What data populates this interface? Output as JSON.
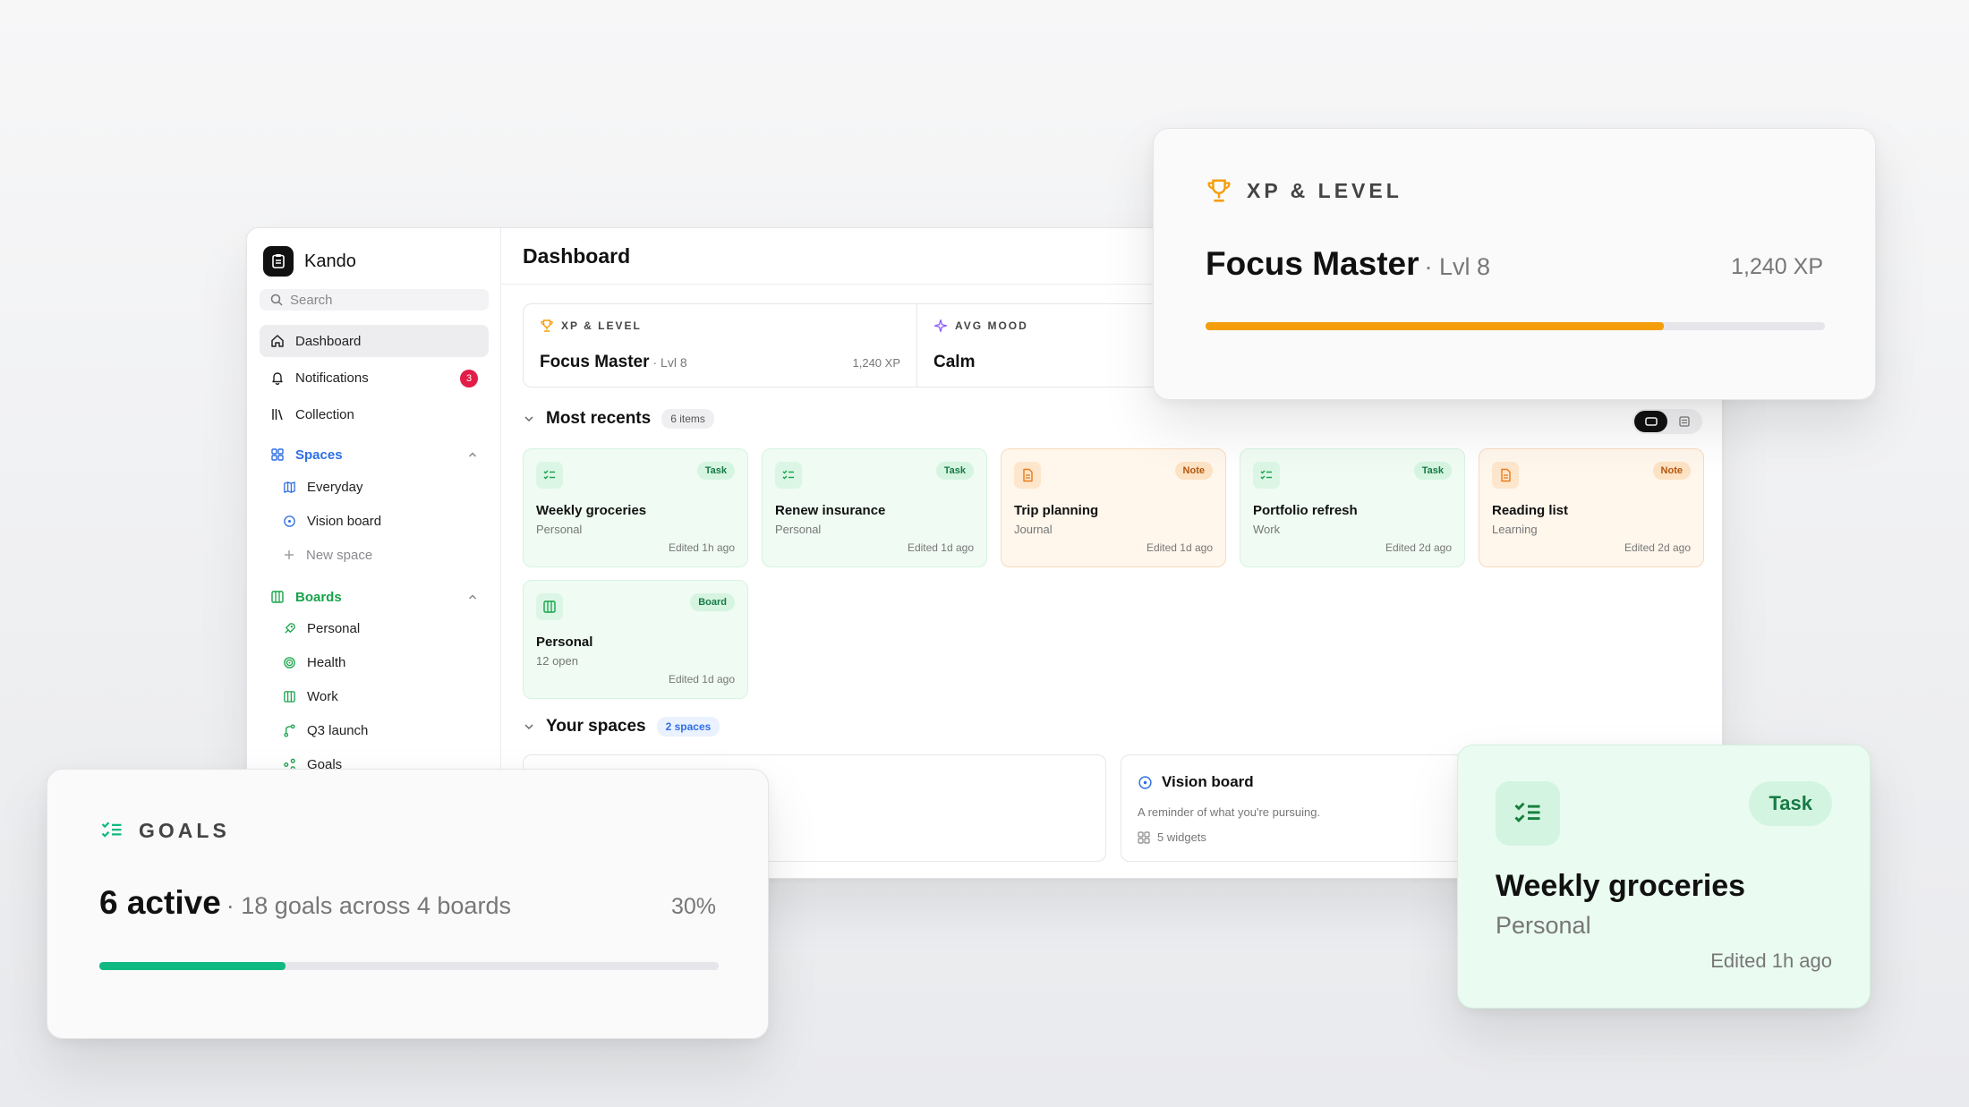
{
  "app": {
    "name": "Kando",
    "search_placeholder": "Search"
  },
  "sidebar": {
    "nav": [
      {
        "label": "Dashboard",
        "icon": "home-icon",
        "active": true
      },
      {
        "label": "Notifications",
        "icon": "bell-icon",
        "badge": "3"
      },
      {
        "label": "Collection",
        "icon": "library-icon"
      }
    ],
    "spaces": {
      "title": "Spaces",
      "items": [
        {
          "label": "Everyday",
          "icon": "map-icon"
        },
        {
          "label": "Vision board",
          "icon": "compass-icon"
        },
        {
          "label": "New space",
          "icon": "plus-icon"
        }
      ]
    },
    "boards": {
      "title": "Boards",
      "items": [
        {
          "label": "Personal",
          "icon": "rocket-icon"
        },
        {
          "label": "Health",
          "icon": "target-icon"
        },
        {
          "label": "Work",
          "icon": "columns-icon"
        },
        {
          "label": "Q3 launch",
          "icon": "branch-icon"
        },
        {
          "label": "Goals",
          "icon": "share-icon"
        }
      ]
    }
  },
  "main": {
    "title": "Dashboard",
    "stats": [
      {
        "label": "XP & LEVEL",
        "value": "Focus Master",
        "sub": "· Lvl 8",
        "right": "1,240 XP"
      },
      {
        "label": "AVG MOOD",
        "value": "Calm"
      }
    ],
    "recents": {
      "title": "Most recents",
      "count": "6 items",
      "cards": [
        {
          "title": "Weekly groceries",
          "sub": "Personal",
          "tag": "Task",
          "time": "Edited 1h ago",
          "kind": "green"
        },
        {
          "title": "Renew insurance",
          "sub": "Personal",
          "tag": "Task",
          "time": "Edited 1d ago",
          "kind": "green"
        },
        {
          "title": "Trip planning",
          "sub": "Journal",
          "tag": "Note",
          "time": "Edited 1d ago",
          "kind": "orange"
        },
        {
          "title": "Portfolio refresh",
          "sub": "Work",
          "tag": "Task",
          "time": "Edited 2d ago",
          "kind": "green"
        },
        {
          "title": "Reading list",
          "sub": "Learning",
          "tag": "Note",
          "time": "Edited 2d ago",
          "kind": "orange"
        },
        {
          "title": "Personal",
          "sub": "12 open",
          "tag": "Board",
          "time": "Edited 1d ago",
          "kind": "green"
        }
      ]
    },
    "spaces": {
      "title": "Your spaces",
      "count": "2 spaces",
      "cards": [
        {
          "title": "",
          "desc": "",
          "meta": ""
        },
        {
          "title": "Vision board",
          "desc": "A reminder of what you're pursuing.",
          "meta": "5 widgets"
        }
      ]
    }
  },
  "float_xp": {
    "label": "XP & LEVEL",
    "value": "Focus Master",
    "sub": "· Lvl 8",
    "right": "1,240 XP",
    "progress": 0.74,
    "color": "#f59e0b"
  },
  "float_goals": {
    "label": "GOALS",
    "value": "6 active",
    "sub": "· 18 goals across 4 boards",
    "right": "30%",
    "progress": 0.3,
    "color": "#10b981"
  },
  "float_task": {
    "tag": "Task",
    "title": "Weekly groceries",
    "sub": "Personal",
    "time": "Edited 1h ago"
  },
  "colors": {
    "accent_blue": "#2f6fe4",
    "accent_green": "#16a34a",
    "notification_red": "#e11d48"
  }
}
